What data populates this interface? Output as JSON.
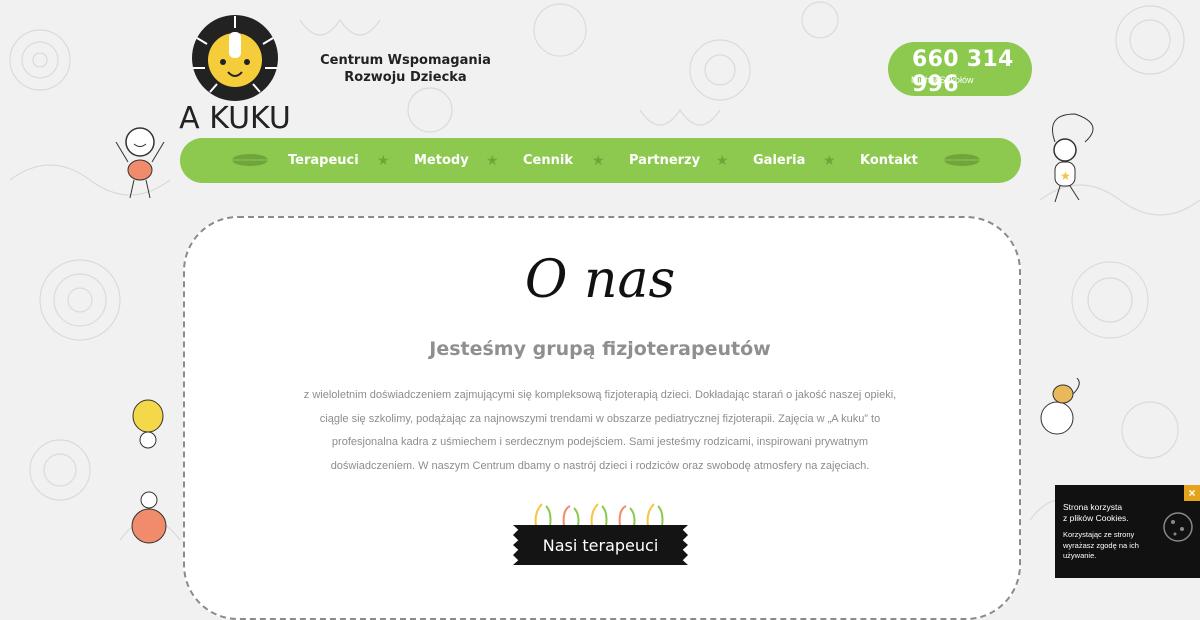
{
  "logo": {
    "text": "A KUKU"
  },
  "header": {
    "tagline_line1": "Centrum Wspomagania",
    "tagline_line2": "Rozwoju Dziecka"
  },
  "phone": {
    "number": "660 314 996",
    "name": "Michał Sokołów"
  },
  "nav": {
    "items": [
      {
        "label": "Terapeuci"
      },
      {
        "label": "Metody"
      },
      {
        "label": "Cennik"
      },
      {
        "label": "Partnerzy"
      },
      {
        "label": "Galeria"
      },
      {
        "label": "Kontakt"
      }
    ]
  },
  "main": {
    "title": "O nas",
    "subtitle": "Jesteśmy grupą fizjoterapeutów",
    "paragraph_lines": [
      "z wieloletnim doświadczeniem zajmującymi się kompleksową fizjoterapią dzieci. Dokładając starań o jakość naszej opieki,",
      "ciągle się szkolimy, podążając za najnowszymi trendami w obszarze pediatrycznej fizjoterapii. Zajęcia w „A kuku” to",
      "profesjonalna kadra z uśmiechem i serdecznym podejściem. Sami jesteśmy rodzicami, inspirowani prywatnym",
      "doświadczeniem. W naszym Centrum dbamy o nastrój dzieci i rodziców oraz swobodę atmosfery na zajęciach."
    ],
    "cta_label": "Nasi terapeuci"
  },
  "cookie": {
    "line1": "Strona korzysta",
    "line2": "z plików Cookies.",
    "line3": "Korzystając ze strony",
    "line4": "wyrażasz zgodę na ich",
    "line5": "używanie.",
    "close": "×"
  },
  "colors": {
    "accent": "#8cc94e",
    "accent_dark": "#6fa53a",
    "cookie_close": "#e4a51c"
  }
}
